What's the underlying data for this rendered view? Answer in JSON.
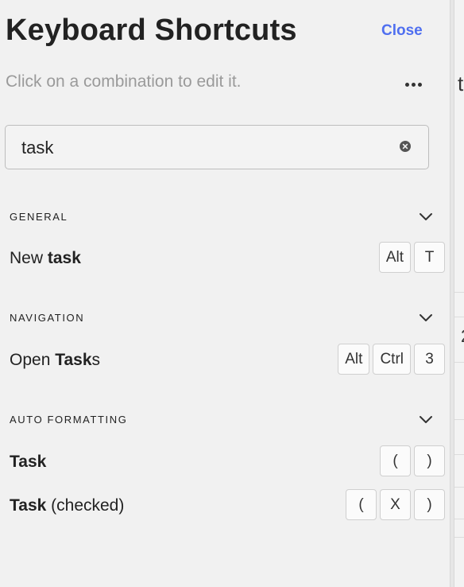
{
  "header": {
    "title": "Keyboard Shortcuts",
    "close_label": "Close",
    "subtitle": "Click on a combination to edit it.",
    "more_icon": "more-horizontal-icon"
  },
  "search": {
    "value": "task",
    "clear_icon": "clear-circle-icon"
  },
  "sections": [
    {
      "title": "GENERAL",
      "rows": [
        {
          "pre": "New ",
          "match": "task",
          "post": "",
          "keys": [
            "Alt",
            "T"
          ]
        }
      ]
    },
    {
      "title": "NAVIGATION",
      "rows": [
        {
          "pre": "Open ",
          "match": "Task",
          "post": "s",
          "keys": [
            "Alt",
            "Ctrl",
            "3"
          ]
        }
      ]
    },
    {
      "title": "AUTO FORMATTING",
      "rows": [
        {
          "pre": "",
          "match": "Task",
          "post": "",
          "keys": [
            "(",
            ")"
          ]
        },
        {
          "pre": "",
          "match": "Task",
          "post": " (checked)",
          "keys": [
            "(",
            "X",
            ")"
          ]
        }
      ]
    }
  ],
  "background_peek": {
    "char_top": "t",
    "char_mid": "2"
  },
  "colors": {
    "accent": "#4f6ff0",
    "panel_bg": "#f1f1f1",
    "muted_text": "#9a9a9a"
  }
}
